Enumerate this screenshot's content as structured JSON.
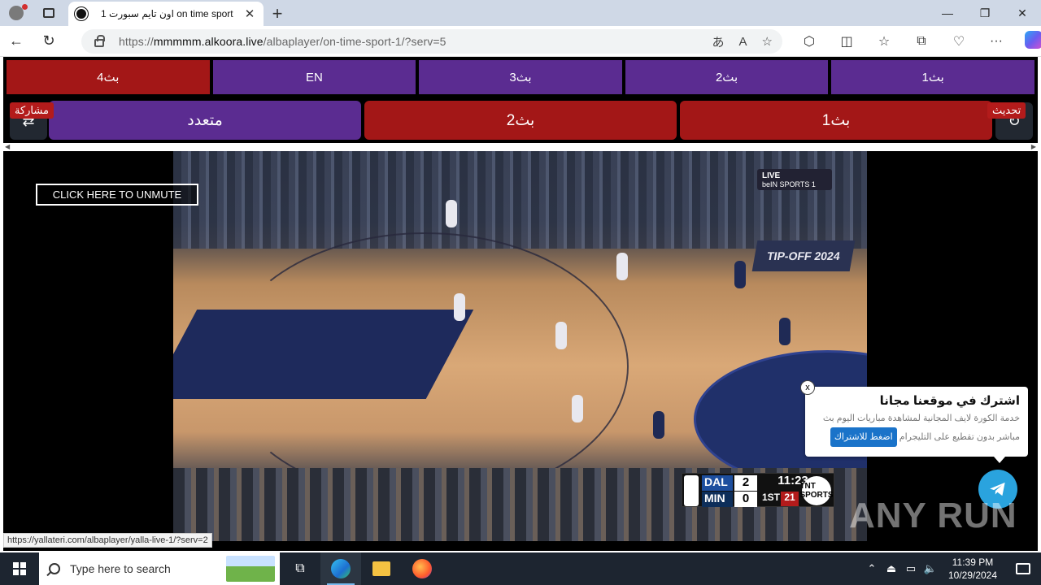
{
  "browser": {
    "tab_title": "اون تايم سبورت 1 on time sport",
    "url_prefix": "https://",
    "url_host": "mmmmm.alkoora.live",
    "url_path": "/albaplayer/on-time-sport-1/?serv=5"
  },
  "servers_row1": [
    "بث4",
    "EN",
    "بث3",
    "بث2",
    "بث1"
  ],
  "servers_row2": {
    "multi": "متعدد",
    "s2": "بث2",
    "s1": "بث1",
    "share": "مشاركة",
    "refresh": "تحديث"
  },
  "player": {
    "unmute": "CLICK HERE TO UNMUTE",
    "channel_logo": "beIN SPORTS 1",
    "live_label": "LIVE",
    "court_banner": "TIP-OFF 2024",
    "scorebug": {
      "home_team": "DAL",
      "home_score": "2",
      "away_team": "MIN",
      "away_score": "0",
      "clock": "11:23",
      "quarter": "1ST",
      "shot_clock": "21",
      "network": "TNT SPORTS"
    }
  },
  "popup": {
    "title": "اشترك في موقعنا مجانا",
    "text_line1": "خدمة الكورة لايف المجانية لمشاهدة مباريات اليوم بث",
    "text_line2": "مباشر بدون تقطيع على التليجرام",
    "cta": "اضغط للاشتراك",
    "close": "x"
  },
  "status_url": "https://yallateri.com/albaplayer/yalla-live-1/?serv=2",
  "watermark": "ANY RUN",
  "taskbar": {
    "search_placeholder": "Type here to search",
    "time": "11:39 PM",
    "date": "10/29/2024"
  },
  "colors": {
    "purple": "#5b2c91",
    "red": "#a31717",
    "active_server": "#a31717"
  }
}
